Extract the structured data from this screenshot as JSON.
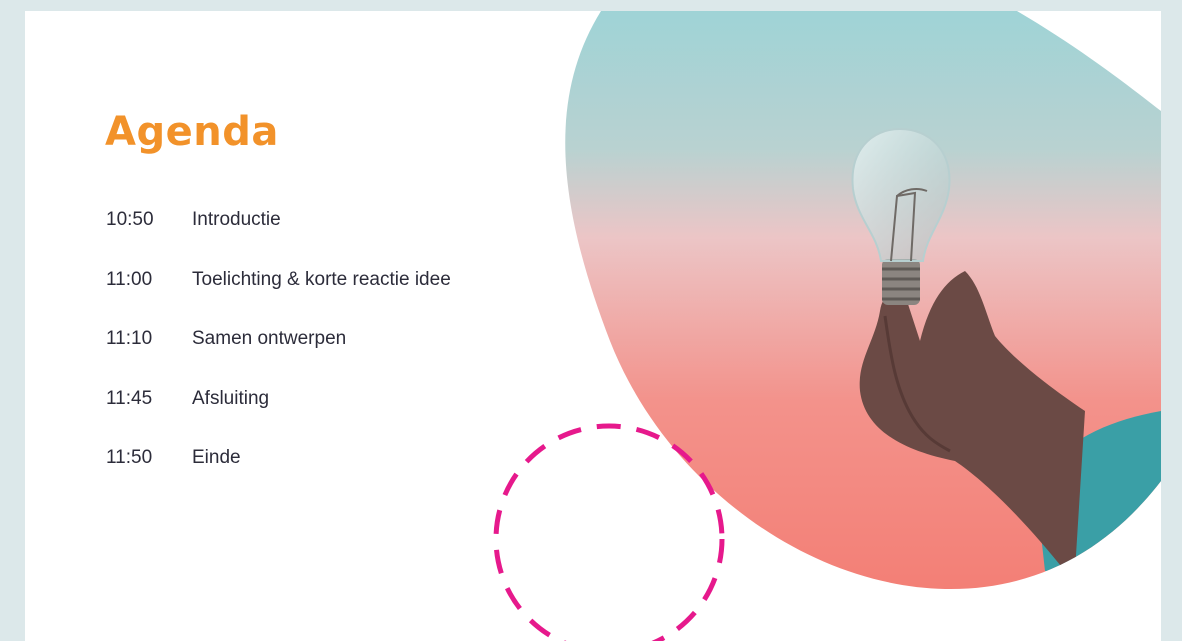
{
  "slide": {
    "title": "Agenda",
    "agenda_items": [
      {
        "time": "10:50",
        "label": "Introductie"
      },
      {
        "time": "11:00",
        "label": "Toelichting & korte reactie idee"
      },
      {
        "time": "11:10",
        "label": "Samen ontwerpen"
      },
      {
        "time": "11:45",
        "label": "Afsluiting"
      },
      {
        "time": "11:50",
        "label": "Einde"
      }
    ]
  },
  "colors": {
    "title": "#f2922a",
    "dashed_circle": "#e6198c",
    "background": "#dce8ea",
    "gradient_top": "#9fd3d6",
    "gradient_middle": "#ecc5c6",
    "gradient_bottom": "#f37a70"
  },
  "icons": [
    "light-bulb-photo",
    "dashed-circle-decoration"
  ]
}
